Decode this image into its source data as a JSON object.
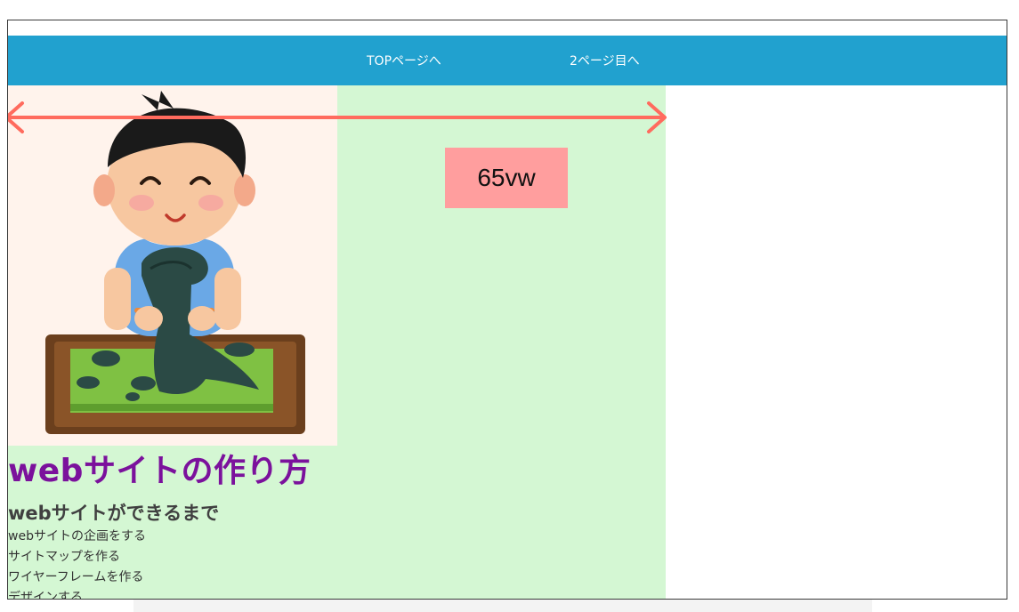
{
  "nav": {
    "items": [
      {
        "label": "TOPページへ"
      },
      {
        "label": "2ページ目へ"
      }
    ],
    "background_color": "#21a1cf"
  },
  "hero": {
    "image_subject": "illustration of a smiling boy sculpting a green clay dinosaur on a wooden board",
    "background_color": "#fff3ec"
  },
  "content": {
    "background_color": "#d4f7d3",
    "title": "webサイトの作り方",
    "title_color": "#7b119c",
    "subtitle": "webサイトができるまで",
    "steps": [
      "webサイトの企画をする",
      "サイトマップを作る",
      "ワイヤーフレームを作る",
      "デザインする"
    ]
  },
  "annotation": {
    "width_label": "65vw",
    "arrow_color": "#ff6b5e",
    "label_background": "#ff9e9e"
  }
}
